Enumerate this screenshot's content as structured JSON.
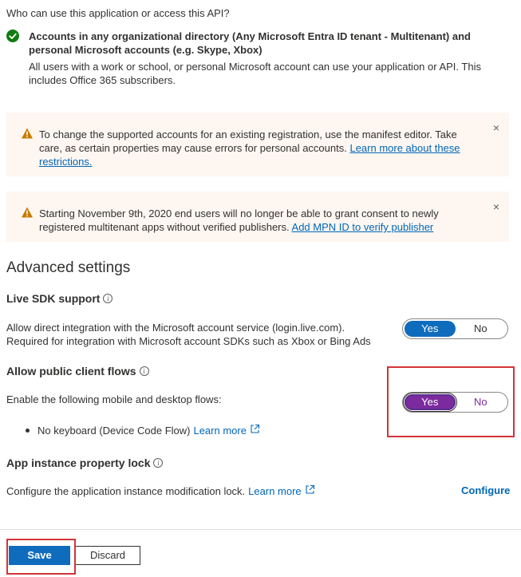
{
  "supported_accounts": {
    "question": "Who can use this application or access this API?",
    "option_title": "Accounts in any organizational directory (Any Microsoft Entra ID tenant - Multitenant) and personal Microsoft accounts (e.g. Skype, Xbox)",
    "option_description": "All users with a work or school, or personal Microsoft account can use your application or API. This includes Office 365 subscribers."
  },
  "warnings": [
    {
      "text": "To change the supported accounts for an existing registration, use the manifest editor. Take care, as certain properties may cause errors for personal accounts.",
      "link": "Learn more about these restrictions.",
      "close": "×"
    },
    {
      "text": "Starting November 9th, 2020 end users will no longer be able to grant consent to newly registered multitenant apps without verified publishers.",
      "link": "Add MPN ID to verify publisher",
      "close": "×"
    }
  ],
  "advanced": {
    "heading": "Advanced settings",
    "live_sdk": {
      "title": "Live SDK support",
      "description": "Allow direct integration with the Microsoft account service (login.live.com). Required for integration with Microsoft account SDKs such as Xbox or Bing Ads",
      "yes": "Yes",
      "no": "No",
      "selected": "Yes"
    },
    "public_client": {
      "title": "Allow public client flows",
      "description": "Enable the following mobile and desktop flows:",
      "yes": "Yes",
      "no": "No",
      "selected": "Yes",
      "bullet": "No keyboard (Device Code Flow)",
      "bullet_link": "Learn more"
    },
    "instance_lock": {
      "title": "App instance property lock",
      "description": "Configure the application instance modification lock.",
      "link": "Learn more",
      "configure": "Configure"
    }
  },
  "footer": {
    "save": "Save",
    "discard": "Discard"
  },
  "colors": {
    "primary": "#0f6cbd",
    "link": "#0067b8",
    "toggle_purple": "#7b2b9e",
    "warning_bg": "#fdf6f1",
    "warning_icon": "#c77b00",
    "success": "#107c10",
    "highlight": "#d13438"
  },
  "icons": {
    "check": "checkmark-circle-icon",
    "warning": "warning-triangle-icon",
    "close": "close-icon",
    "info": "info-icon",
    "external": "external-link-icon"
  }
}
